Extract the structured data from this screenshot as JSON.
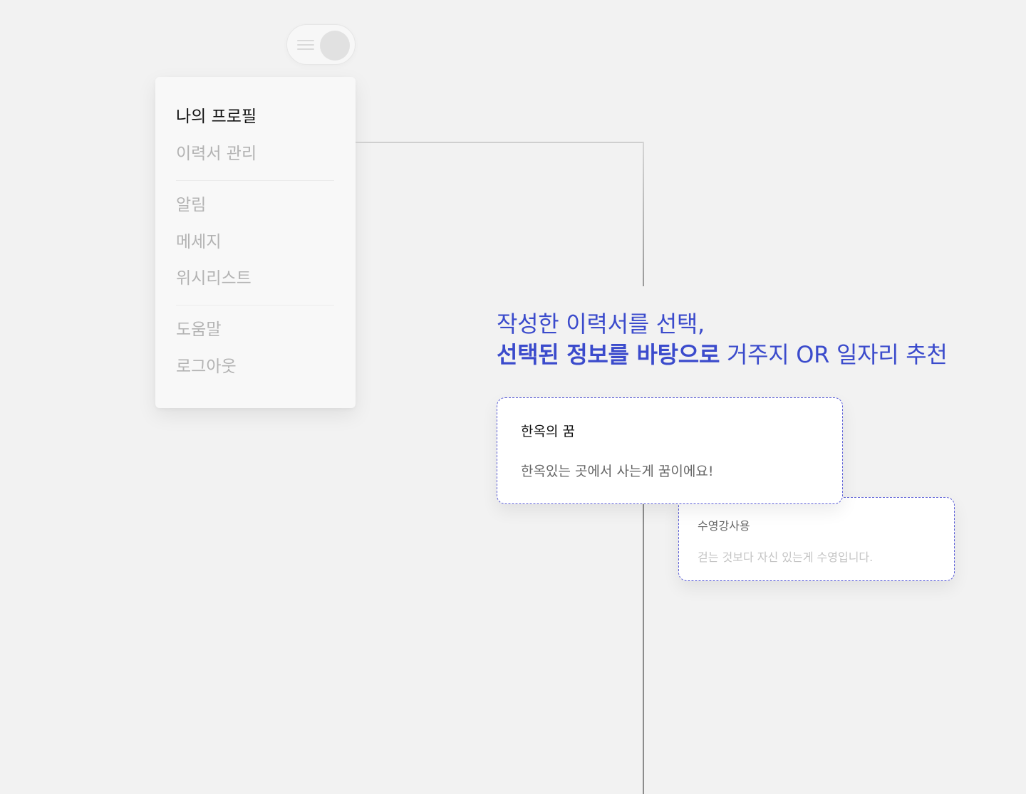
{
  "menu": {
    "groups": [
      [
        "나의 프로필",
        "이력서 관리"
      ],
      [
        "알림",
        "메세지",
        "위시리스트"
      ],
      [
        "도움말",
        "로그아웃"
      ]
    ],
    "active": "나의 프로필"
  },
  "headline": {
    "line1": "작성한 이력서를 선택,",
    "line2_bold": "선택된 정보를 바탕으로",
    "line2_rest": " 거주지 OR 일자리 추천"
  },
  "cards": [
    {
      "title": "한옥의 꿈",
      "desc": "한옥있는 곳에서 사는게 꿈이에요!"
    },
    {
      "title": "수영강사용",
      "desc": "걷는 것보다 자신 있는게 수영입니다."
    }
  ],
  "colors": {
    "accent": "#3b4bcc",
    "background": "#f2f2f2",
    "card_border": "#5b5ed6"
  },
  "icons": {
    "toggle": "menu-toggle-icon"
  }
}
